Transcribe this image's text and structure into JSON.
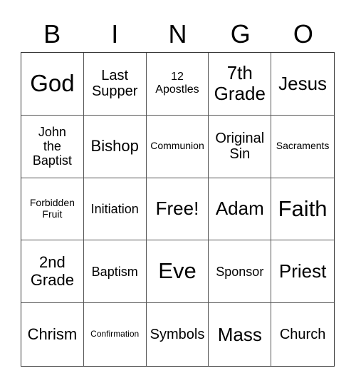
{
  "header": {
    "letters": [
      "B",
      "I",
      "N",
      "G",
      "O"
    ]
  },
  "card": {
    "rows": [
      [
        {
          "text": "God",
          "size": "fs-xxxl"
        },
        {
          "text": "Last\nSupper",
          "size": "fs-l"
        },
        {
          "text": "12\nApostles",
          "size": "fs-m"
        },
        {
          "text": "7th\nGrade",
          "size": "fs-xl"
        },
        {
          "text": "Jesus",
          "size": "fs-xl"
        }
      ],
      [
        {
          "text": "John\nthe\nBaptist",
          "size": "fs-ml"
        },
        {
          "text": "Bishop",
          "size": "fs-lx"
        },
        {
          "text": "Communion",
          "size": "fs-s"
        },
        {
          "text": "Original\nSin",
          "size": "fs-l"
        },
        {
          "text": "Sacraments",
          "size": "fs-s"
        }
      ],
      [
        {
          "text": "Forbidden\nFruit",
          "size": "fs-s"
        },
        {
          "text": "Initiation",
          "size": "fs-ml"
        },
        {
          "text": "Free!",
          "size": "fs-xl"
        },
        {
          "text": "Adam",
          "size": "fs-xl"
        },
        {
          "text": "Faith",
          "size": "fs-xxl"
        }
      ],
      [
        {
          "text": "2nd\nGrade",
          "size": "fs-lx"
        },
        {
          "text": "Baptism",
          "size": "fs-ml"
        },
        {
          "text": "Eve",
          "size": "fs-xxl"
        },
        {
          "text": "Sponsor",
          "size": "fs-ml"
        },
        {
          "text": "Priest",
          "size": "fs-xl"
        }
      ],
      [
        {
          "text": "Chrism",
          "size": "fs-lx"
        },
        {
          "text": "Confirmation",
          "size": "fs-xs"
        },
        {
          "text": "Symbols",
          "size": "fs-l"
        },
        {
          "text": "Mass",
          "size": "fs-xl"
        },
        {
          "text": "Church",
          "size": "fs-l"
        }
      ]
    ]
  }
}
